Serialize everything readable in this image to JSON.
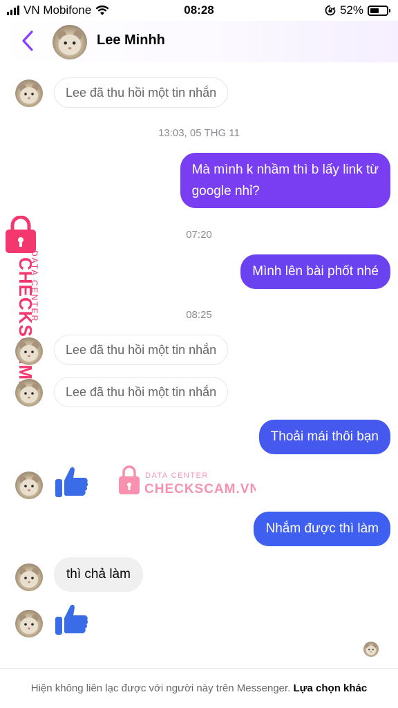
{
  "status_bar": {
    "carrier": "VN Mobifone",
    "time": "08:28",
    "battery_percent": "52%",
    "battery_level": 0.52
  },
  "header": {
    "contact_name": "Lee Minhh"
  },
  "messages": {
    "notice_1": "Lee đã thu hồi một tin nhắn",
    "timestamp_1": "13:03, 05 THG 11",
    "out_1_line1": "Mà mình k nhầm thì b lấy link từ",
    "out_1_line2": "google nhỉ?",
    "timestamp_2": "07:20",
    "out_2": "Mình lên bài phốt nhé",
    "timestamp_3": "08:25",
    "notice_2": "Lee đã thu hồi một tin nhắn",
    "notice_3": "Lee đã thu hồi một tin nhắn",
    "out_3": "Thoải mái thôi bạn",
    "out_4": "Nhắm được thì làm",
    "in_1": "thì chả làm"
  },
  "watermark": {
    "line1": "DATA CENTER",
    "line2": "CHECKSCAM.VN"
  },
  "footer": {
    "text": "Hiện không liên lạc được với người này trên Messenger.",
    "link": "Lựa chọn khác"
  },
  "colors": {
    "bubble_purple": "#7a3ef2",
    "bubble_violet": "#5b47ee",
    "bubble_blue": "#3f5ff0",
    "like_blue": "#3b6ce8",
    "back_arrow": "#8a3ffc",
    "watermark_pink": "#f2386f"
  },
  "icons": [
    "back-arrow-icon",
    "like-icon",
    "signal-icon",
    "wifi-icon",
    "rotation-lock-icon",
    "battery-icon",
    "lock-icon"
  ]
}
